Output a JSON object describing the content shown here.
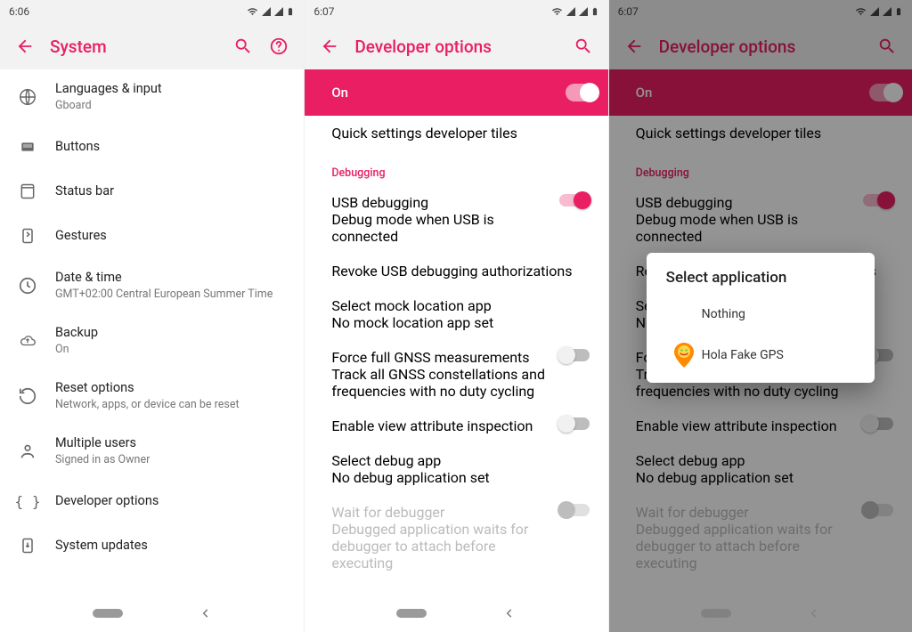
{
  "panel1": {
    "clock": "6:06",
    "title": "System",
    "items": [
      {
        "label": "Languages & input",
        "sub": "Gboard"
      },
      {
        "label": "Buttons"
      },
      {
        "label": "Status bar"
      },
      {
        "label": "Gestures"
      },
      {
        "label": "Date & time",
        "sub": "GMT+02:00 Central European Summer Time"
      },
      {
        "label": "Backup",
        "sub": "On"
      },
      {
        "label": "Reset options",
        "sub": "Network, apps, or device can be reset"
      },
      {
        "label": "Multiple users",
        "sub": "Signed in as Owner"
      },
      {
        "label": "Developer options"
      },
      {
        "label": "System updates"
      }
    ]
  },
  "panel2": {
    "clock": "6:07",
    "title": "Developer options",
    "master": "On",
    "quick_tiles": "Quick settings developer tiles",
    "section_debugging": "Debugging",
    "usb_debugging": {
      "title": "USB debugging",
      "sub": "Debug mode when USB is connected"
    },
    "revoke": {
      "title": "Revoke USB debugging authorizations"
    },
    "mock": {
      "title": "Select mock location app",
      "sub": "No mock location app set"
    },
    "gnss": {
      "title": "Force full GNSS measurements",
      "sub": "Track all GNSS constellations and frequencies with no duty cycling"
    },
    "view_attr": {
      "title": "Enable view attribute inspection"
    },
    "debug_app": {
      "title": "Select debug app",
      "sub": "No debug application set"
    },
    "wait": {
      "title": "Wait for debugger",
      "sub": "Debugged application waits for debugger to attach before executing"
    }
  },
  "panel3": {
    "clock": "6:07",
    "title": "Developer options",
    "dialog": {
      "title": "Select application",
      "nothing": "Nothing",
      "hola": "Hola Fake GPS"
    }
  }
}
